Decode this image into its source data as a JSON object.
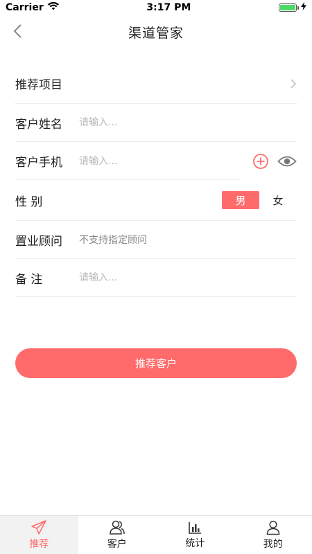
{
  "status_bar": {
    "carrier": "Carrier",
    "time": "3:17 PM"
  },
  "nav": {
    "title": "渠道管家"
  },
  "form": {
    "project_label": "推荐项目",
    "name_label": "客户姓名",
    "name_placeholder": "请输入...",
    "phone_label": "客户手机",
    "phone_placeholder": "请输入...",
    "gender_label": "性 别",
    "gender_options": [
      "男",
      "女"
    ],
    "gender_selected": "男",
    "advisor_label": "置业顾问",
    "advisor_value": "不支持指定顾问",
    "remark_label": "备 注",
    "remark_placeholder": "请输入..."
  },
  "submit_label": "推荐客户",
  "tabs": [
    {
      "label": "推荐",
      "icon": "paper-plane-icon",
      "active": true
    },
    {
      "label": "客户",
      "icon": "users-icon",
      "active": false
    },
    {
      "label": "统计",
      "icon": "bar-chart-icon",
      "active": false
    },
    {
      "label": "我的",
      "icon": "user-icon",
      "active": false
    }
  ],
  "colors": {
    "accent": "#ff6b6b",
    "battery": "#4cd964"
  }
}
